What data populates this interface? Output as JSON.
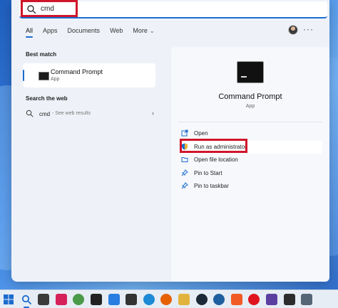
{
  "search": {
    "value": "cmd"
  },
  "filters": {
    "tabs": [
      {
        "label": "All",
        "active": true
      },
      {
        "label": "Apps",
        "active": false
      },
      {
        "label": "Documents",
        "active": false
      },
      {
        "label": "Web",
        "active": false
      },
      {
        "label": "More",
        "active": false
      }
    ]
  },
  "left": {
    "best_match_label": "Best match",
    "best_match": {
      "title": "Command Prompt",
      "subtitle": "App"
    },
    "web_label": "Search the web",
    "web_result": {
      "query": "cmd",
      "suffix": "- See web results"
    }
  },
  "detail": {
    "title": "Command Prompt",
    "subtitle": "App",
    "actions": [
      {
        "label": "Open",
        "icon": "open-icon"
      },
      {
        "label": "Run as administrator",
        "icon": "shield-icon"
      },
      {
        "label": "Open file location",
        "icon": "folder-icon"
      },
      {
        "label": "Pin to Start",
        "icon": "pin-icon"
      },
      {
        "label": "Pin to taskbar",
        "icon": "pin-icon"
      }
    ]
  },
  "taskbar": {
    "icons": [
      {
        "name": "windows-start-icon",
        "color": "#1a6ccf"
      },
      {
        "name": "search-icon",
        "color": "#1a6ccf"
      },
      {
        "name": "file-explorer-icon",
        "color": "#3a3a3a"
      },
      {
        "name": "app-red-icon",
        "color": "#d6205a"
      },
      {
        "name": "chrome-icon",
        "color": "#4a9a4a"
      },
      {
        "name": "notion-icon",
        "color": "#222222"
      },
      {
        "name": "todo-check-icon",
        "color": "#2a7de1"
      },
      {
        "name": "sticky-notes-icon",
        "color": "#333333"
      },
      {
        "name": "edge-icon",
        "color": "#1c8ad4"
      },
      {
        "name": "firefox-icon",
        "color": "#e66000"
      },
      {
        "name": "folder-icon",
        "color": "#e2b33c"
      },
      {
        "name": "steam-icon",
        "color": "#1b2838"
      },
      {
        "name": "app-blue-circle-icon",
        "color": "#1f5f9f"
      },
      {
        "name": "brave-icon",
        "color": "#f15a24"
      },
      {
        "name": "opera-icon",
        "color": "#e0141e"
      },
      {
        "name": "app-purple-icon",
        "color": "#5a3fa0"
      },
      {
        "name": "app-dark-icon",
        "color": "#2c2c2c"
      },
      {
        "name": "app-photo-icon",
        "color": "#556677"
      }
    ]
  }
}
